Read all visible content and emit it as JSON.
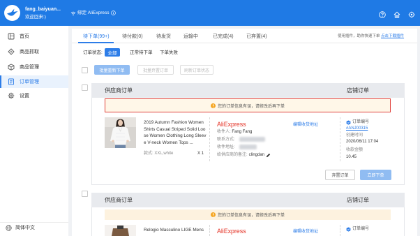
{
  "colors": {
    "brand": "#1f7ae5",
    "accent": "#2d7de8",
    "warning": "#f5a623",
    "danger": "#e0403a",
    "aliexpress": "#e43225"
  },
  "header": {
    "username": "fang_baiyuan...",
    "welcome": "欢迎回来:)",
    "bind_label": "绑定 AliExpress",
    "icons": [
      "help-icon",
      "home-icon",
      "settings-icon"
    ]
  },
  "sidebar": {
    "items": [
      {
        "label": "首页",
        "icon": "dashboard-icon",
        "active": false
      },
      {
        "label": "商品抓取",
        "icon": "tag-icon",
        "active": false
      },
      {
        "label": "商品管理",
        "icon": "box-icon",
        "active": false
      },
      {
        "label": "订单管理",
        "icon": "order-icon",
        "active": true
      },
      {
        "label": "设置",
        "icon": "gear-icon",
        "active": false
      }
    ],
    "language": "简体中文"
  },
  "tabs": [
    {
      "label": "待下单(99+)",
      "active": true
    },
    {
      "label": "待付款(0)",
      "active": false
    },
    {
      "label": "待发货",
      "active": false
    },
    {
      "label": "运输中",
      "active": false
    },
    {
      "label": "已完成(4)",
      "active": false
    },
    {
      "label": "已弃置(4)",
      "active": false
    }
  ],
  "plugin_hint": {
    "text": "使用插件，助你快速下单",
    "link": "点击下载插件"
  },
  "filter": {
    "label": "订单状态:",
    "options": [
      {
        "label": "全部",
        "selected": true
      },
      {
        "label": "正常待下单",
        "selected": false
      },
      {
        "label": "下单失败",
        "selected": false
      }
    ]
  },
  "bulk_actions": {
    "reorder": "批量重新下单",
    "discard": "批量弃置订单",
    "refresh": "刷新订单状态"
  },
  "orders": [
    {
      "supplier_header": "供应商订单",
      "store_header": "店铺订单",
      "warning": "您的订单信息有误，请修改后再下单",
      "highlighted": true,
      "product": {
        "title": "2019 Autumn Fashion Women Shirts Casual Striped Solid Loose Women Clothing Long Sleeve V-neck Women Tops ...",
        "style": "款式: XXL,white",
        "qty": "X 1"
      },
      "supplier": "AliExpress",
      "edit_address": "编辑收货地址",
      "recipient_label": "收件人:",
      "recipient_name": "Fang Fang",
      "contact_label": "联系方式:",
      "address_label": "收件地址:",
      "note_label": "给供应商的备注:",
      "note": "clingdan",
      "order_no_label": "订单编号",
      "order_no": "#ANJ00315",
      "created_label": "创建时间",
      "created": "2020/06/11 17:04",
      "amount_label": "收款金额",
      "amount": "10.45",
      "discard_button": "弃置订单",
      "order_button": "立即下单"
    },
    {
      "supplier_header": "供应商订单",
      "store_header": "店铺订单",
      "warning": "您的订单信息有误，请修改后再下单",
      "highlighted": false,
      "product": {
        "title": "Relogio Masculino LIGE Mens"
      },
      "supplier": "AliExpress",
      "edit_address": "编辑收货地址",
      "order_no_label": "订单编号"
    }
  ]
}
